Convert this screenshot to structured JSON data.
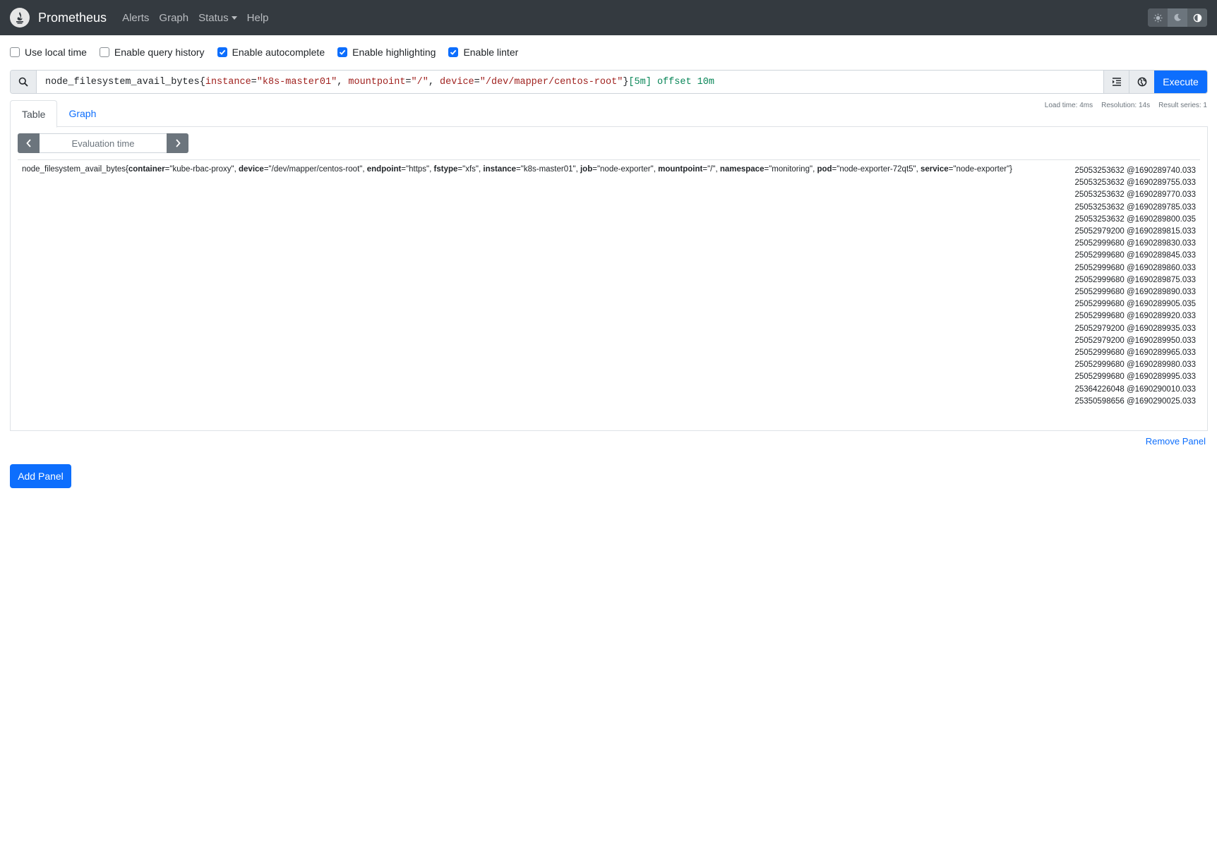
{
  "navbar": {
    "brand": "Prometheus",
    "links": [
      "Alerts",
      "Graph",
      "Status",
      "Help"
    ]
  },
  "options": [
    {
      "label": "Use local time",
      "checked": false
    },
    {
      "label": "Enable query history",
      "checked": false
    },
    {
      "label": "Enable autocomplete",
      "checked": true
    },
    {
      "label": "Enable highlighting",
      "checked": true
    },
    {
      "label": "Enable linter",
      "checked": true
    }
  ],
  "query": {
    "metric": "node_filesystem_avail_bytes",
    "open_brace": "{",
    "label1": "instance",
    "value1": "\"k8s-master01\"",
    "label2": "mountpoint",
    "value2": "\"/\"",
    "label3": "device",
    "value3": "\"/dev/mapper/centos-root\"",
    "close_brace": "}",
    "range": "[5m]",
    "offset_kw": "offset",
    "offset_val": "10m",
    "execute_label": "Execute"
  },
  "stats": {
    "load_time": "Load time: 4ms",
    "resolution": "Resolution: 14s",
    "result_series": "Result series: 1"
  },
  "tabs": [
    "Table",
    "Graph"
  ],
  "eval_placeholder": "Evaluation time",
  "series": {
    "metric": "node_filesystem_avail_bytes",
    "labels": [
      {
        "key": "container",
        "value": "\"kube-rbac-proxy\""
      },
      {
        "key": "device",
        "value": "\"/dev/mapper/centos-root\""
      },
      {
        "key": "endpoint",
        "value": "\"https\""
      },
      {
        "key": "fstype",
        "value": "\"xfs\""
      },
      {
        "key": "instance",
        "value": "\"k8s-master01\""
      },
      {
        "key": "job",
        "value": "\"node-exporter\""
      },
      {
        "key": "mountpoint",
        "value": "\"/\""
      },
      {
        "key": "namespace",
        "value": "\"monitoring\""
      },
      {
        "key": "pod",
        "value": "\"node-exporter-72qt5\""
      },
      {
        "key": "service",
        "value": "\"node-exporter\""
      }
    ],
    "values": [
      "25053253632 @1690289740.033",
      "25053253632 @1690289755.033",
      "25053253632 @1690289770.033",
      "25053253632 @1690289785.033",
      "25053253632 @1690289800.035",
      "25052979200 @1690289815.033",
      "25052999680 @1690289830.033",
      "25052999680 @1690289845.033",
      "25052999680 @1690289860.033",
      "25052999680 @1690289875.033",
      "25052999680 @1690289890.033",
      "25052999680 @1690289905.035",
      "25052999680 @1690289920.033",
      "25052979200 @1690289935.033",
      "25052979200 @1690289950.033",
      "25052999680 @1690289965.033",
      "25052999680 @1690289980.033",
      "25052999680 @1690289995.033",
      "25364226048 @1690290010.033",
      "25350598656 @1690290025.033"
    ]
  },
  "remove_panel": "Remove Panel",
  "add_panel": "Add Panel",
  "colors": {
    "navbar": "#343a40",
    "primary": "#0d6efd",
    "label_string": "#a0221f",
    "duration": "#098658"
  }
}
